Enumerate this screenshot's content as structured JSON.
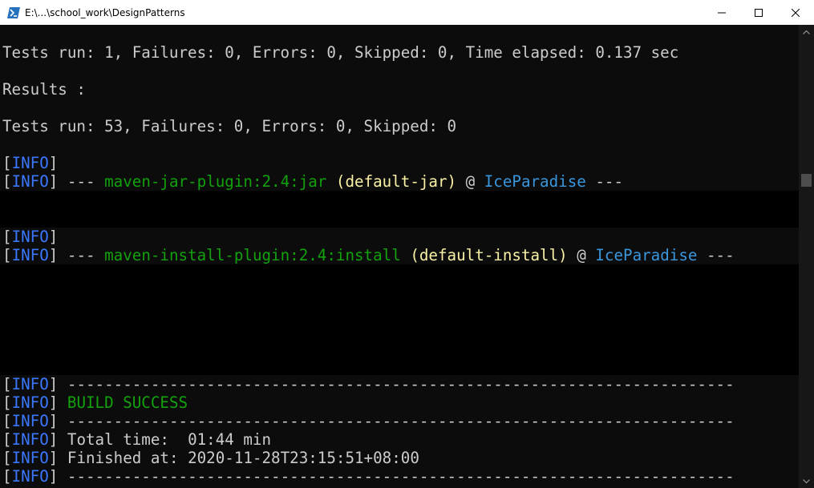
{
  "window": {
    "title": "E:\\...\\school_work\\DesignPatterns"
  },
  "console": {
    "tests_line": "Tests run: 1, Failures: 0, Errors: 0, Skipped: 0, Time elapsed: 0.137 sec",
    "results_label": "Results :",
    "tests_summary": "Tests run: 53, Failures: 0, Errors: 0, Skipped: 0",
    "info_tag": "INFO",
    "open_bracket": "[",
    "close_bracket": "]",
    "jar_line": {
      "dashes_start": " --- ",
      "plugin": "maven-jar-plugin:2.4:jar",
      "execution": " (default-jar)",
      "at": " @ ",
      "project": "IceParadise",
      "dashes_end": " ---"
    },
    "install_line": {
      "dashes_start": " --- ",
      "plugin": "maven-install-plugin:2.4:install",
      "execution": " (default-install)",
      "at": " @ ",
      "project": "IceParadise",
      "dashes_end": " ---"
    },
    "separator": " ------------------------------------------------------------------------",
    "build_success": " BUILD SUCCESS",
    "total_time": " Total time:  01:44 min",
    "finished_at": " Finished at: 2020-11-28T23:15:51+08:00"
  },
  "colors": {
    "background": "#0c0c0c",
    "text": "#cccccc",
    "info": "#3b78ff",
    "success": "#13a10e",
    "plugin": "#13a10e",
    "execution": "#f9f1a5",
    "project": "#3a96dd"
  },
  "icons": {
    "app": "powershell-icon",
    "minimize": "minimize-icon",
    "maximize": "maximize-icon",
    "close": "close-icon",
    "scroll_up": "chevron-up-icon",
    "scroll_down": "chevron-down-icon"
  }
}
